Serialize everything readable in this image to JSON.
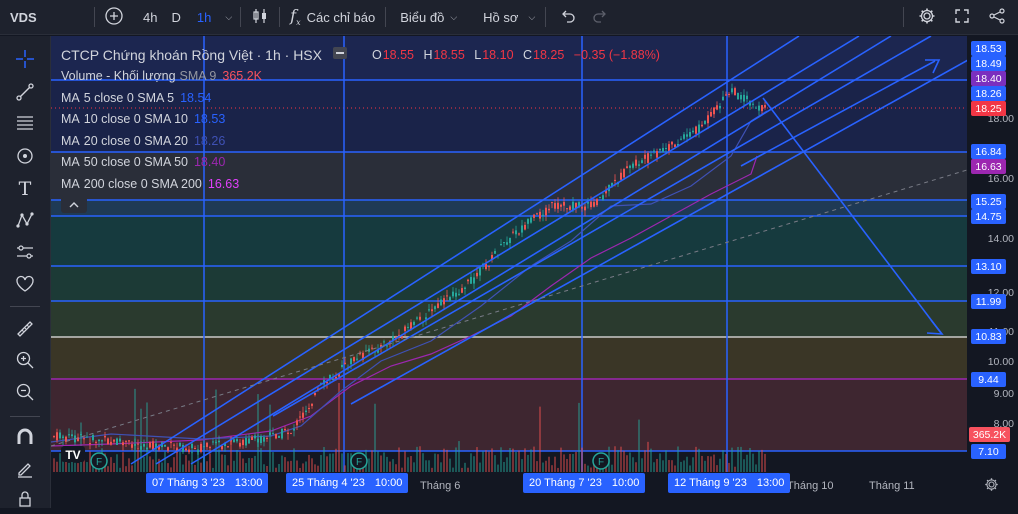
{
  "toolbar": {
    "symbol": "VDS",
    "intervals": [
      "4h",
      "D",
      "1h"
    ],
    "active_interval": "1h",
    "indicators_label": "Các chỉ báo",
    "chart_menu_label": "Biểu đồ",
    "profile_menu_label": "Hồ sơ"
  },
  "legend": {
    "title": "CTCP Chứng khoán Rồng Việt · 1h · HSX",
    "ohlc": [
      {
        "k": "O",
        "v": "18.55"
      },
      {
        "k": "H",
        "v": "18.55"
      },
      {
        "k": "L",
        "v": "18.10"
      },
      {
        "k": "C",
        "v": "18.25"
      }
    ],
    "change": "−0.35 (−1.88%)",
    "rows": [
      {
        "name": "Volume - Khối lượng",
        "sub": "SMA 9",
        "value": "365.2K",
        "color": "#f7525f"
      },
      {
        "name": "MA",
        "sub": "5 close 0 SMA 5",
        "value": "18.54",
        "color": "#2962ff"
      },
      {
        "name": "MA",
        "sub": "10 close 0 SMA 10",
        "value": "18.53",
        "color": "#2962ff"
      },
      {
        "name": "MA",
        "sub": "20 close 0 SMA 20",
        "value": "18.26",
        "color": "#3f51b5"
      },
      {
        "name": "MA",
        "sub": "50 close 0 SMA 50",
        "value": "18.40",
        "color": "#9c27b0"
      },
      {
        "name": "MA",
        "sub": "200 close 0 SMA 200",
        "value": "16.63",
        "color": "#e040fb"
      }
    ]
  },
  "price_scale": {
    "labels": [
      "18.00",
      "16.00",
      "14.00",
      "12.00",
      "11.00",
      "10.00",
      "9.00",
      "8.00"
    ],
    "badges": [
      {
        "text": "18.53",
        "color": "#2962ff"
      },
      {
        "text": "18.49",
        "color": "#2962ff"
      },
      {
        "text": "18.40",
        "color": "#7b2fbe"
      },
      {
        "text": "18.26",
        "color": "#2962ff"
      },
      {
        "text": "18.25",
        "color": "#f23645"
      },
      {
        "text": "16.84",
        "color": "#2962ff"
      },
      {
        "text": "16.63",
        "color": "#9c27b0"
      },
      {
        "text": "15.25",
        "color": "#2962ff"
      },
      {
        "text": "14.75",
        "color": "#2962ff"
      },
      {
        "text": "13.10",
        "color": "#2962ff"
      },
      {
        "text": "11.99",
        "color": "#2962ff"
      },
      {
        "text": "10.83",
        "color": "#2962ff"
      },
      {
        "text": "9.44",
        "color": "#2962ff"
      },
      {
        "text": "7.10",
        "color": "#2962ff"
      },
      {
        "text": "365.2K",
        "color": "#f7525f"
      }
    ]
  },
  "time_scale": {
    "labels": [
      "Tháng 6",
      "Tháng 10",
      "Tháng 11"
    ],
    "badges": [
      {
        "date": "07 Tháng 3 '23",
        "time": "13:00"
      },
      {
        "date": "25 Tháng 4 '23",
        "time": "10:00"
      },
      {
        "date": "20 Tháng 7 '23",
        "time": "10:00"
      },
      {
        "date": "12 Tháng 9 '23",
        "time": "13:00"
      }
    ]
  },
  "markers": {
    "earnings_letter": "F",
    "logo_letters": "TV"
  },
  "colors": {
    "background": "#131722",
    "up_candle": "#26a69a",
    "down_candle": "#ef5350",
    "drawing": "#2962ff",
    "toolbar": "#1e222d"
  }
}
